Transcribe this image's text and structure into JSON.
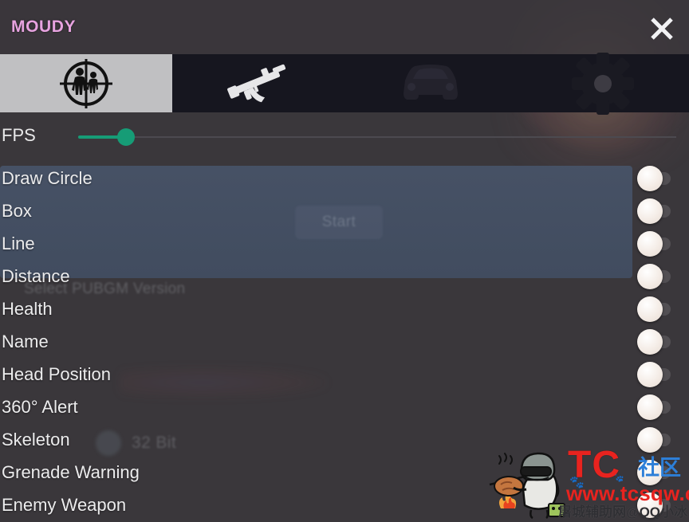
{
  "window": {
    "title": "MOUDY",
    "title_color": "#e7a3e0",
    "close_icon": "close-icon",
    "background_color": "#3a373b"
  },
  "tabs": [
    {
      "id": "aim",
      "icon": "crosshair-player-icon",
      "selected": true
    },
    {
      "id": "weapon",
      "icon": "rifle-icon",
      "selected": false
    },
    {
      "id": "vehicle",
      "icon": "car-icon",
      "selected": false
    },
    {
      "id": "settings",
      "icon": "gear-icon",
      "selected": false
    }
  ],
  "fps": {
    "label": "FPS",
    "value_fraction": 0.08,
    "accent_color": "#169c76",
    "track_color": "#4c4a50"
  },
  "options": [
    {
      "label": "Draw Circle",
      "on": false
    },
    {
      "label": "Box",
      "on": false
    },
    {
      "label": "Line",
      "on": false
    },
    {
      "label": "Distance",
      "on": false
    },
    {
      "label": "Health",
      "on": false
    },
    {
      "label": "Name",
      "on": false
    },
    {
      "label": "Head Position",
      "on": false
    },
    {
      "label": "360° Alert",
      "on": false
    },
    {
      "label": "Skeleton",
      "on": false
    },
    {
      "label": "Grenade Warning",
      "on": false
    },
    {
      "label": "Enemy Weapon",
      "on": false
    }
  ],
  "background_window": {
    "start_button": "Start",
    "version_label": "Select PUBGM Version",
    "bit_label": "32 Bit",
    "panel_color": "#48556b"
  },
  "watermark": {
    "brand": "TC",
    "brand_color": "#e8231f",
    "community": "社区",
    "community_color": "#2d7fd8",
    "url": "www.tcsqw.com",
    "subtitle": "屠城辅助网@QQ小冰",
    "art": "pubg-character-icon"
  }
}
